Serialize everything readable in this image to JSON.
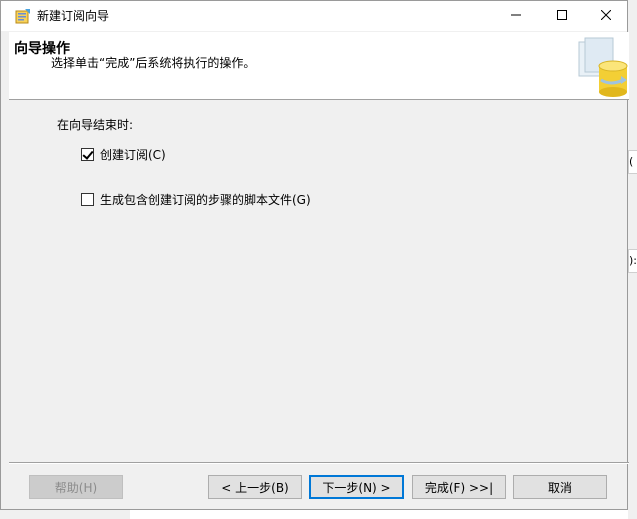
{
  "window": {
    "title": "新建订阅向导",
    "minimize_icon": "minimize-icon",
    "maximize_icon": "maximize-icon",
    "close_icon": "close-icon"
  },
  "banner": {
    "title": "向导操作",
    "subtitle": "选择单击“完成”后系统将执行的操作。",
    "graphic": "database-wizard-graphic"
  },
  "content": {
    "section_label": "在向导结束时:",
    "options": [
      {
        "label": "创建订阅(C)",
        "checked": true
      },
      {
        "label": "生成包含创建订阅的步骤的脚本文件(G)",
        "checked": false
      }
    ]
  },
  "buttons": {
    "help": "帮助(H)",
    "back": "< 上一步(B)",
    "next": "下一步(N) >",
    "finish": "完成(F) >>|",
    "cancel": "取消"
  },
  "background": {
    "right_tab1_text": "(",
    "right_tab2_text": "):"
  }
}
